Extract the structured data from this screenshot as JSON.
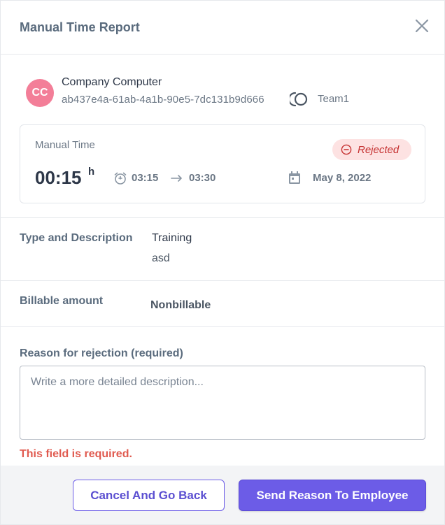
{
  "header": {
    "title": "Manual Time Report",
    "close_icon": "close-icon"
  },
  "user": {
    "initials": "CC",
    "avatar_color": "#f37e98",
    "name": "Company Computer",
    "id": "ab437e4a-61ab-4a1b-90e5-7dc131b9d666",
    "team": "Team1"
  },
  "entry": {
    "label": "Manual Time",
    "status": "Rejected",
    "status_color": "#c53030",
    "duration": "00:15",
    "duration_unit": "h",
    "start": "03:15",
    "end": "03:30",
    "date": "May 8, 2022"
  },
  "details": {
    "type_label": "Type and Description",
    "type_value": "Training",
    "description": "asd",
    "billable_label": "Billable amount",
    "billable_value": "Nonbillable"
  },
  "rejection": {
    "label": "Reason for rejection (required)",
    "placeholder": "Write a more detailed description...",
    "value": "",
    "error": "This field is required.",
    "error_color": "#e05a4f"
  },
  "footer": {
    "cancel_label": "Cancel And Go Back",
    "send_label": "Send Reason To Employee",
    "accent": "#6c5ce7"
  }
}
